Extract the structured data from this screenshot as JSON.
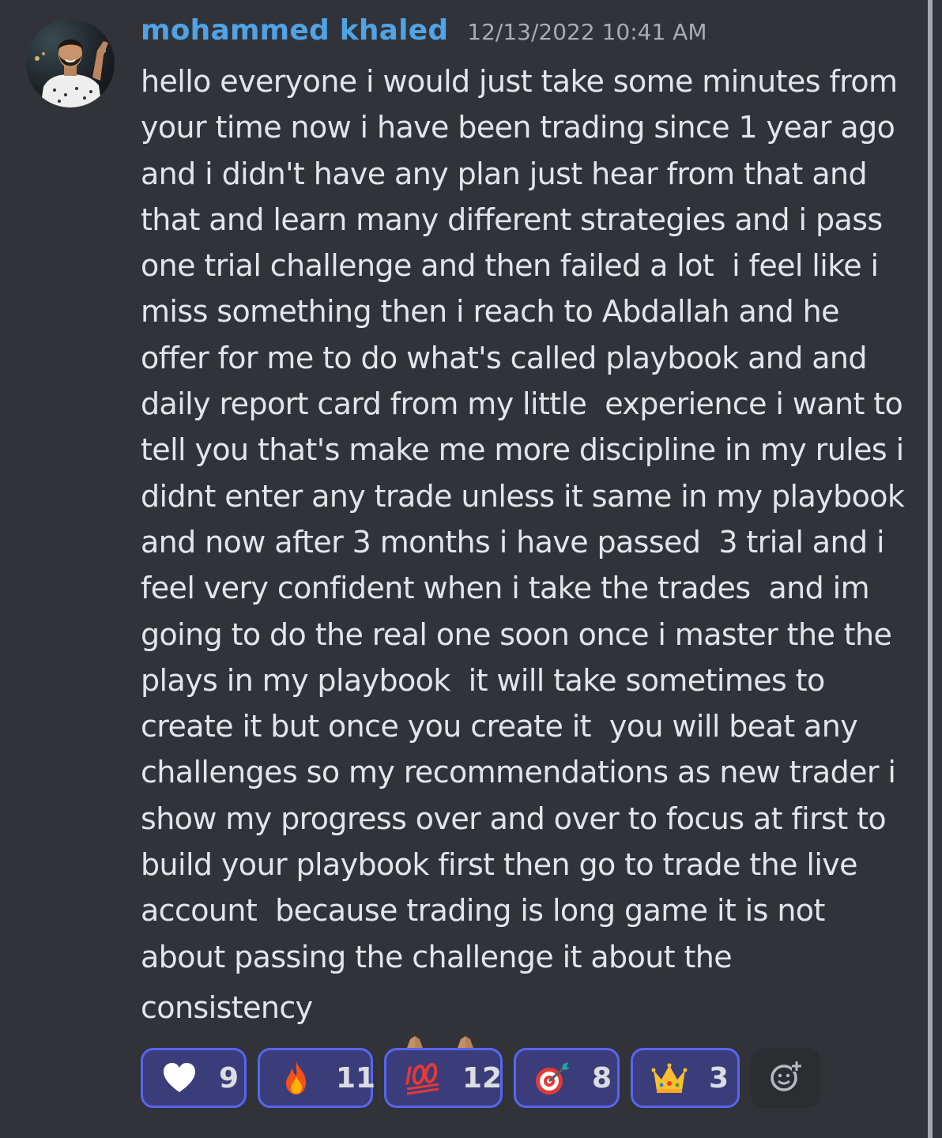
{
  "message": {
    "author": "mohammed khaled",
    "timestamp": "12/13/2022 10:41 AM",
    "lines": [
      "hello everyone i would just take some minutes from",
      "your time now i have been trading since 1 year ago",
      "and i didn't have any plan just hear from that and",
      "that and learn many different strategies and i pass",
      "one trial challenge and then failed a lot  i feel like i",
      "miss something then i reach to Abdallah and he",
      "offer for me to do what's called playbook and and",
      "daily report card from my little  experience i want to",
      "tell you that's make me more discipline in my rules i",
      "didnt enter any trade unless it same in my playbook",
      "and now after 3 months i have passed  3 trial and i",
      "feel very confident when i take the trades  and im",
      "going to do the real one soon once i master the the",
      "plays in my playbook  it will take sometimes to",
      "create it but once you create it  you will beat any",
      "challenges so my recommendations as new trader i",
      "show my progress over and over to focus at first to",
      "build your playbook first then go to trade the live",
      "account  because trading is long game it is not",
      "about passing the challenge it about the"
    ],
    "last_line": "consistency",
    "trailing_emojis": [
      "folded-hands",
      "folded-hands"
    ]
  },
  "reactions": [
    {
      "emoji": "white-heart",
      "count": "9"
    },
    {
      "emoji": "fire",
      "count": "11"
    },
    {
      "emoji": "hundred-points",
      "count": "12"
    },
    {
      "emoji": "direct-hit",
      "count": "8"
    },
    {
      "emoji": "crown",
      "count": "3"
    }
  ],
  "add_reaction_icon": "add-reaction-icon",
  "colors": {
    "background": "#313338",
    "username": "#4fa3e6",
    "text": "#e3e5e8",
    "timestamp": "#a9acb2",
    "reaction_border": "#5865f2",
    "reaction_bg": "#3b3d7a"
  }
}
